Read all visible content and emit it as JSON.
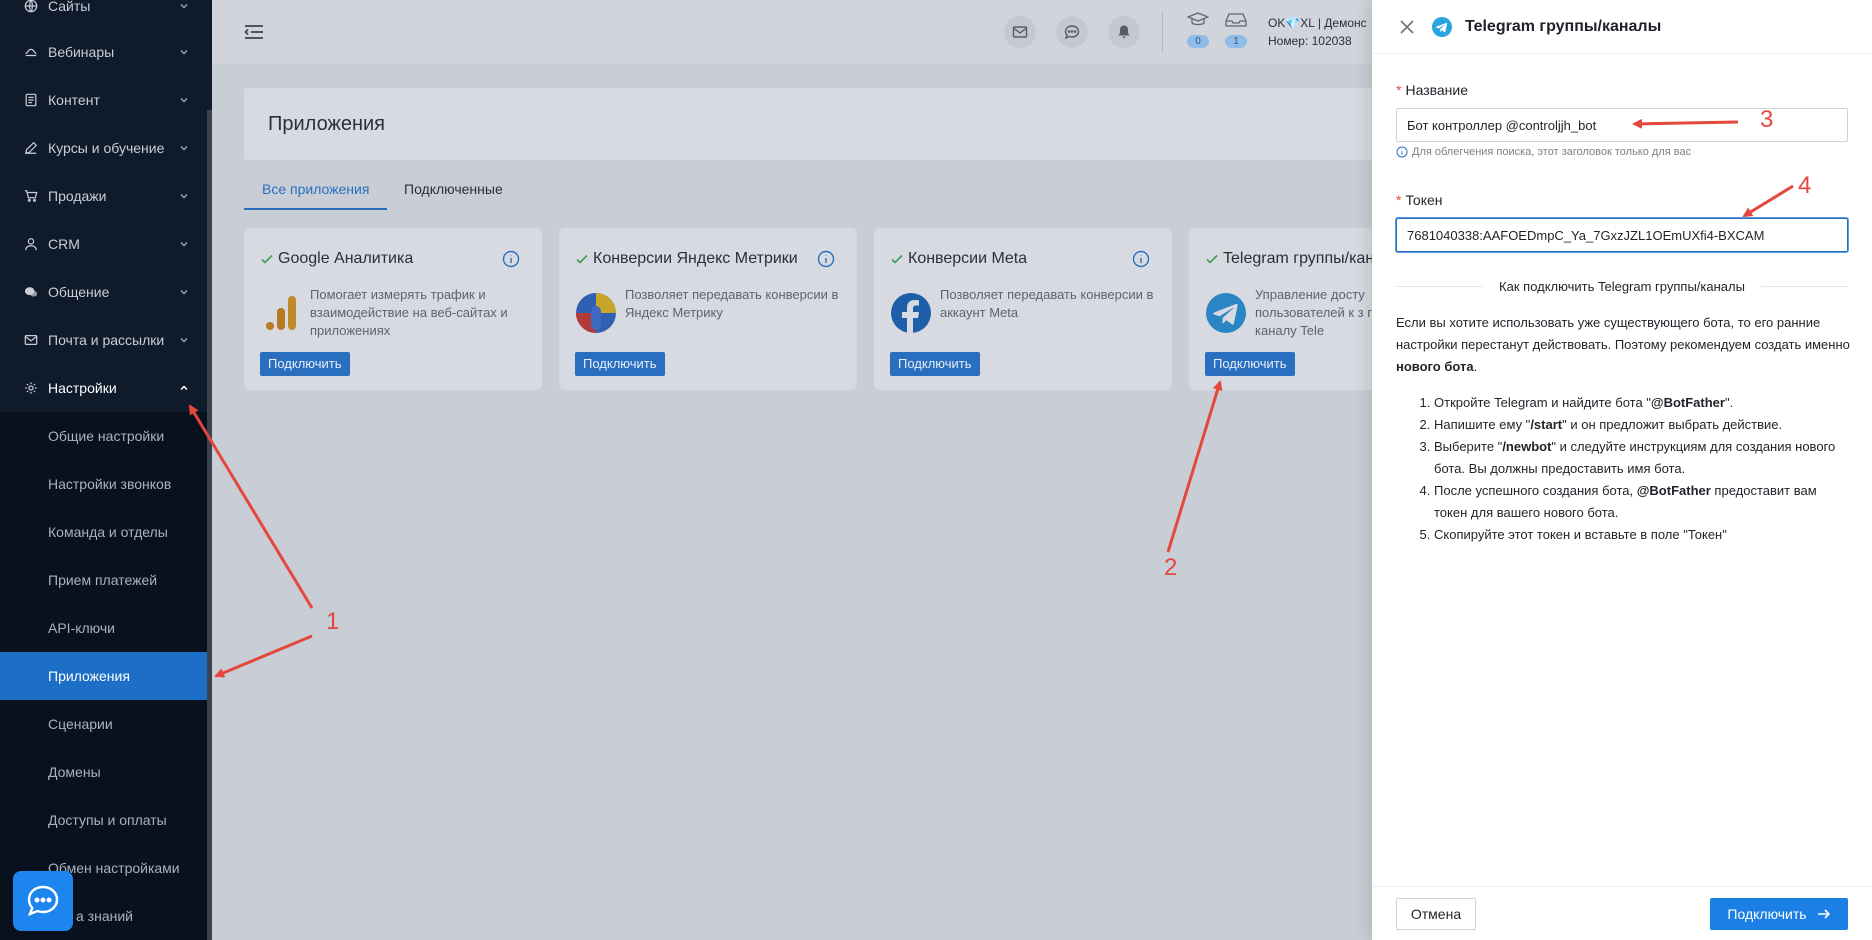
{
  "sidebar": {
    "items": [
      {
        "label": "Сайты",
        "icon": "globe-icon"
      },
      {
        "label": "Вебинары",
        "icon": "video-icon"
      },
      {
        "label": "Контент",
        "icon": "file-icon"
      },
      {
        "label": "Курсы и обучение",
        "icon": "edit-icon"
      },
      {
        "label": "Продажи",
        "icon": "cart-icon"
      },
      {
        "label": "CRM",
        "icon": "user-icon"
      },
      {
        "label": "Общение",
        "icon": "chat-icon"
      },
      {
        "label": "Почта и рассылки",
        "icon": "mail-icon"
      },
      {
        "label": "Настройки",
        "icon": "gear-icon"
      }
    ],
    "sub_items": [
      {
        "label": "Общие настройки"
      },
      {
        "label": "Настройки звонков"
      },
      {
        "label": "Команда и отделы"
      },
      {
        "label": "Прием платежей"
      },
      {
        "label": "API-ключи"
      },
      {
        "label": "Приложения",
        "active": true
      },
      {
        "label": "Сценарии"
      },
      {
        "label": "Домены"
      },
      {
        "label": "Доступы и оплаты"
      },
      {
        "label": "Обмен настройками"
      },
      {
        "label": "База знаний"
      }
    ],
    "visible_tail": "а знаний"
  },
  "header": {
    "counters": [
      {
        "value": "0"
      },
      {
        "value": "1"
      }
    ],
    "account_name": "OK💎XL | Демонс",
    "account_number": "Номер: 102038"
  },
  "page": {
    "title": "Приложения",
    "tabs": [
      {
        "label": "Все приложения",
        "active": true
      },
      {
        "label": "Подключенные",
        "active": false
      }
    ]
  },
  "apps": [
    {
      "title": "Google Аналитика",
      "description": "Помогает измерять трафик и взаимодействие на веб-сайтах и приложениях",
      "button": "Подключить",
      "logo": "google-analytics-logo"
    },
    {
      "title": "Конверсии Яндекс Метрики",
      "description": "Позволяет передавать конверсии в Яндекс Метрику",
      "button": "Подключить",
      "logo": "yandex-metrica-logo"
    },
    {
      "title": "Конверсии Meta",
      "description": "Позволяет передавать конверсии в аккаунт Meta",
      "button": "Подключить",
      "logo": "facebook-logo"
    },
    {
      "title": "Telegram группы/кана",
      "description": "Управление досту пользователей к з группе/каналу Tele",
      "button": "Подключить",
      "logo": "telegram-logo"
    }
  ],
  "drawer": {
    "title": "Telegram группы/каналы",
    "name_label": "Название",
    "name_value": "Бот контроллер @controljjh_bot",
    "name_hint": "Для облегчения поиска, этот заголовок только для вас",
    "token_label": "Токен",
    "token_value": "7681040338:AAFOEDmpC_Ya_7GxzJZL1OEmUXfi4-BXCAM",
    "howto_title": "Как подключить Telegram группы/каналы",
    "intro_1": "Если вы хотите использовать уже существующего бота, то его ранние настройки перестанут действовать. Поэтому рекомендуем создать именно ",
    "intro_bold": "нового бота",
    "intro_2": ".",
    "steps": [
      {
        "pre": "Откройте Telegram и найдите бота \"",
        "bold": "@BotFather",
        "post": "\"."
      },
      {
        "pre": "Напишите ему \"",
        "bold": "/start",
        "post": "\" и он предложит выбрать действие."
      },
      {
        "pre": "Выберите \"",
        "bold": "/newbot",
        "post": "\" и следуйте инструкциям для создания нового бота. Вы должны предоставить имя бота."
      },
      {
        "pre": "После успешного создания бота, ",
        "bold": "@BotFather",
        "post": " предоставит вам токен для вашего нового бота."
      },
      {
        "pre": "Скопируйте этот токен и вставьте в поле \"Токен\"",
        "bold": "",
        "post": ""
      }
    ],
    "cancel_label": "Отмена",
    "connect_label": "Подключить"
  },
  "annotations": {
    "labels": [
      "1",
      "2",
      "3",
      "4"
    ],
    "color": "#e5473c"
  },
  "colors": {
    "accent": "#1c7fe6",
    "sidebar_bg": "#0f1a2a",
    "active_item": "#1c6fc4",
    "required": "#e14b3f"
  }
}
